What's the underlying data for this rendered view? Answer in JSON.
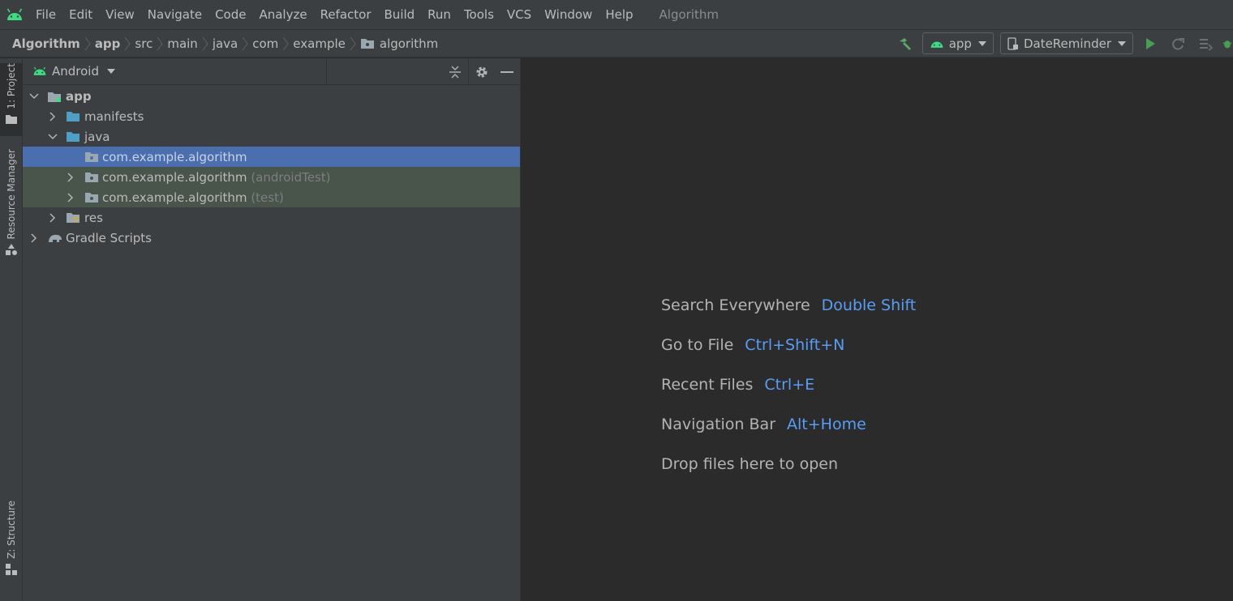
{
  "menubar": {
    "items": [
      "File",
      "Edit",
      "View",
      "Navigate",
      "Code",
      "Analyze",
      "Refactor",
      "Build",
      "Run",
      "Tools",
      "VCS",
      "Window",
      "Help"
    ],
    "window_title": "Algorithm"
  },
  "breadcrumbs": {
    "project": "Algorithm",
    "module": "app",
    "items": [
      "src",
      "main",
      "java",
      "com",
      "example"
    ],
    "package": "algorithm"
  },
  "toolbar": {
    "module_config": "app",
    "run_config": "DateReminder"
  },
  "left_strip": {
    "project_tab": "1: Project",
    "resource_tab": "Resource Manager",
    "structure_tab": "Z: Structure"
  },
  "project_panel": {
    "view_mode": "Android",
    "tree": {
      "app": "app",
      "manifests": "manifests",
      "java": "java",
      "pkg_main": "com.example.algorithm",
      "pkg_android_test": "com.example.algorithm",
      "pkg_android_test_suffix": "(androidTest)",
      "pkg_test": "com.example.algorithm",
      "pkg_test_suffix": "(test)",
      "res": "res",
      "gradle": "Gradle Scripts"
    }
  },
  "editor_hints": [
    {
      "text": "Search Everywhere",
      "key": "Double Shift"
    },
    {
      "text": "Go to File",
      "key": "Ctrl+Shift+N"
    },
    {
      "text": "Recent Files",
      "key": "Ctrl+E"
    },
    {
      "text": "Navigation Bar",
      "key": "Alt+Home"
    },
    {
      "text": "Drop files here to open",
      "key": ""
    }
  ],
  "colors": {
    "android_green": "#3ddc84",
    "selection": "#4b6eaf",
    "test_bg": "#49544a",
    "shortcut": "#589df6",
    "folder_blue": "#4e9ec5"
  }
}
